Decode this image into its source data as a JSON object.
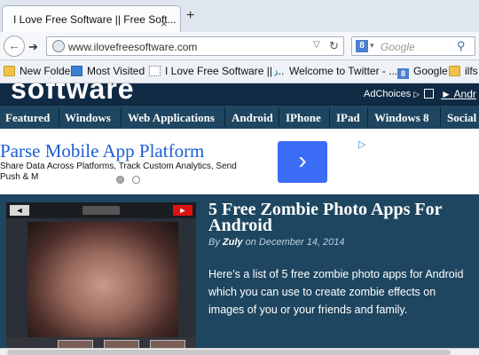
{
  "browser": {
    "tab_title": "I Love Free Software || Free Soft...",
    "tab_close": "×",
    "new_tab": "+",
    "url": "www.ilovefreesoftware.com",
    "search_placeholder": "Google",
    "bookmarks": [
      {
        "label": "New Folder",
        "icon": "folder-icon"
      },
      {
        "label": "Most Visited",
        "icon": "most-visited-icon"
      },
      {
        "label": "I Love Free Software || ...",
        "icon": "page-icon"
      },
      {
        "label": "Welcome to Twitter - ...",
        "icon": "twitter-icon"
      },
      {
        "label": "Google",
        "icon": "google-icon"
      },
      {
        "label": "ilfs",
        "icon": "folder-icon"
      }
    ]
  },
  "site": {
    "logo": "software",
    "adchoices": "AdChoices",
    "ad_link": "► Andr",
    "menu": [
      "Featured",
      "Windows",
      "Web Applications",
      "Android",
      "IPhone",
      "IPad",
      "Windows 8",
      "Social"
    ]
  },
  "ad": {
    "title": "Parse Mobile App Platform",
    "description": "Share Data Across Platforms, Track Custom Analytics, Send Push & M",
    "button": "›",
    "choice_icon": "▷"
  },
  "article": {
    "title": "5 Free Zombie Photo Apps For Android",
    "by": "By",
    "author": "Zuly",
    "on": "on",
    "date": "December 14, 2014",
    "body": "Here’s a list of 5 free zombie photo apps for Android which you can use to create zombie effects on images of you or your friends and family."
  },
  "colors": {
    "site_dark": "#102a44",
    "menu_bg": "#1e4660",
    "ad_title": "#1b5fd6",
    "ad_button": "#3a6cf6"
  }
}
